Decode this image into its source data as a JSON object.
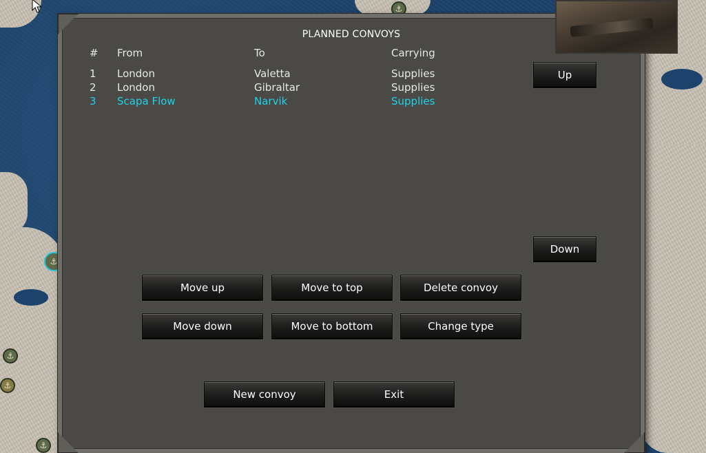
{
  "dialog": {
    "title": "PLANNED CONVOYS",
    "columns": {
      "num": "#",
      "from": "From",
      "to": "To",
      "carrying": "Carrying"
    },
    "rows": [
      {
        "num": "1",
        "from": "London",
        "to": "Valetta",
        "carrying": "Supplies",
        "selected": false
      },
      {
        "num": "2",
        "from": "London",
        "to": "Gibraltar",
        "carrying": "Supplies",
        "selected": false
      },
      {
        "num": "3",
        "from": "Scapa Flow",
        "to": "Narvik",
        "carrying": "Supplies",
        "selected": true
      }
    ],
    "selected_color": "#1fd3e8",
    "buttons": {
      "up": "Up",
      "down": "Down",
      "move_up": "Move up",
      "move_to_top": "Move to top",
      "delete_convoy": "Delete convoy",
      "move_down": "Move down",
      "move_to_bottom": "Move to bottom",
      "change_type": "Change type",
      "new_convoy": "New convoy",
      "exit": "Exit"
    }
  },
  "map": {
    "port_icon": "anchor-icon",
    "highlight_color": "#23c6dc"
  }
}
